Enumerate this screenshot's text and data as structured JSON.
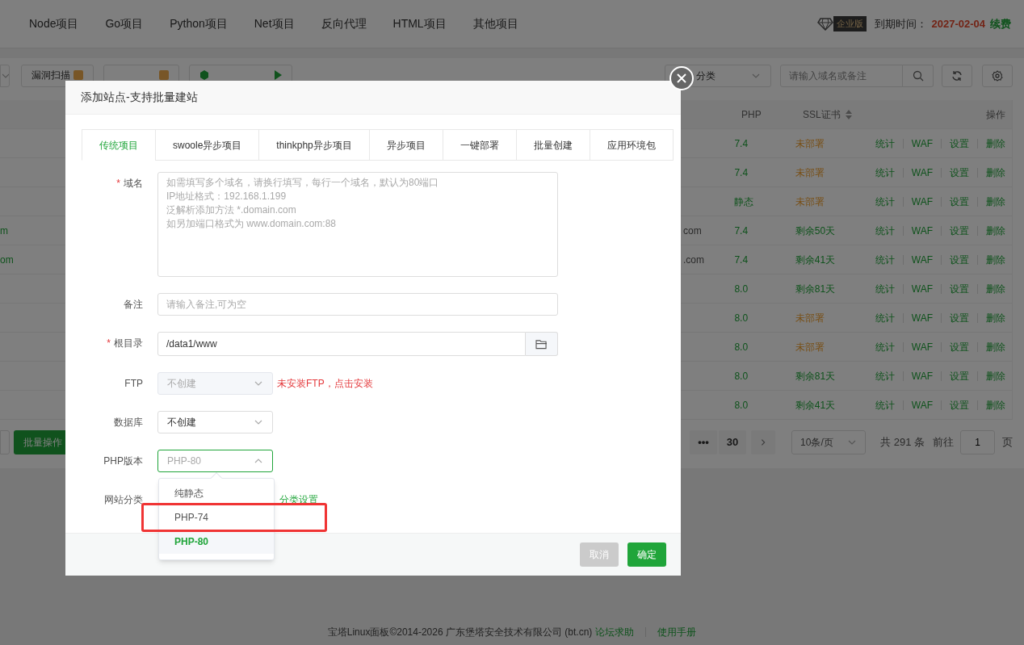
{
  "top_nav": {
    "items": [
      "Node项目",
      "Go项目",
      "Python项目",
      "Net项目",
      "反向代理",
      "HTML项目",
      "其他项目"
    ],
    "edition_badge": "企业版",
    "expiry_label": "到期时间：",
    "expiry_date": "2027-02-04",
    "renew_link": "续费"
  },
  "toolbar": {
    "left_buttons": [
      {
        "label": "漏洞扫描",
        "kind": "badge"
      },
      {
        "kind": "badge"
      },
      {
        "kind": "server"
      }
    ],
    "category_select": "分类",
    "search": {
      "placeholder": "请输入域名或备注"
    }
  },
  "table": {
    "columns": [
      "PHP",
      "SSL证书",
      "操作"
    ],
    "rows": [
      {
        "php": "7.4",
        "ssl": "未部署",
        "ssl_deployed": false,
        "actions": [
          "统计",
          "WAF",
          "设置",
          "删除"
        ]
      },
      {
        "php": "7.4",
        "ssl": "未部署",
        "ssl_deployed": false,
        "actions": [
          "统计",
          "WAF",
          "设置",
          "删除"
        ]
      },
      {
        "php": "静态",
        "ssl": "未部署",
        "ssl_deployed": false,
        "actions": [
          "统计",
          "WAF",
          "设置",
          "删除"
        ]
      },
      {
        "lead": "m",
        "tail": "com",
        "php": "7.4",
        "ssl": "剩余50天",
        "ssl_deployed": true,
        "actions": [
          "统计",
          "WAF",
          "设置",
          "删除"
        ]
      },
      {
        "lead": "om",
        "tail": ".com",
        "php": "7.4",
        "ssl": "剩余41天",
        "ssl_deployed": true,
        "actions": [
          "统计",
          "WAF",
          "设置",
          "删除"
        ]
      },
      {
        "php": "8.0",
        "ssl": "剩余81天",
        "ssl_deployed": true,
        "actions": [
          "统计",
          "WAF",
          "设置",
          "删除"
        ]
      },
      {
        "php": "8.0",
        "ssl": "未部署",
        "ssl_deployed": false,
        "actions": [
          "统计",
          "WAF",
          "设置",
          "删除"
        ]
      },
      {
        "php": "8.0",
        "ssl": "未部署",
        "ssl_deployed": false,
        "actions": [
          "统计",
          "WAF",
          "设置",
          "删除"
        ]
      },
      {
        "php": "8.0",
        "ssl": "剩余81天",
        "ssl_deployed": true,
        "actions": [
          "统计",
          "WAF",
          "设置",
          "删除"
        ]
      },
      {
        "php": "8.0",
        "ssl": "剩余41天",
        "ssl_deployed": true,
        "actions": [
          "统计",
          "WAF",
          "设置",
          "删除"
        ]
      }
    ]
  },
  "pagination": {
    "batch_button": "批量操作",
    "pages": [
      "•••",
      "30"
    ],
    "page_size": "10条/页",
    "total": "共 291 条",
    "goto_label": "前往",
    "goto_value": "1",
    "page_unit": "页"
  },
  "footer": {
    "copyright": "宝塔Linux面板©2014-2026 广东堡塔安全技术有限公司 (bt.cn)",
    "links": [
      "论坛求助",
      "使用手册"
    ]
  },
  "dialog": {
    "title": "添加站点-支持批量建站",
    "tabs": [
      {
        "label": "传统项目",
        "selected": true
      },
      {
        "label": "swoole异步项目",
        "selected": false
      },
      {
        "label": "thinkphp异步项目",
        "selected": false
      },
      {
        "label": "异步项目",
        "selected": false
      },
      {
        "label": "一键部署",
        "selected": false
      },
      {
        "label": "批量创建",
        "selected": false
      },
      {
        "label": "应用环境包",
        "selected": false
      }
    ],
    "fields": [
      {
        "kind": "textarea",
        "label": "域名",
        "required_mark": "*",
        "placeholder": "如需填写多个域名，请换行填写，每行一个域名，默认为80端口\nIP地址格式：192.168.1.199\n泛解析添加方法 *.domain.com\n如另加端口格式为 www.domain.com:88"
      },
      {
        "kind": "input",
        "label": "备注",
        "placeholder": "请输入备注,可为空"
      },
      {
        "kind": "path",
        "label": "根目录",
        "required_mark": "*",
        "value": "/data1/www"
      },
      {
        "kind": "select",
        "label": "FTP",
        "value": "不创建",
        "disabled": true,
        "note": "未安装FTP，点击安装"
      },
      {
        "kind": "select",
        "label": "数据库",
        "value": "不创建",
        "disabled": false
      },
      {
        "kind": "select",
        "label": "PHP版本",
        "placeholder": "PHP-80",
        "disabled": false,
        "expanded": true,
        "options": [
          {
            "label": "纯静态",
            "selected": false,
            "highlighted": false
          },
          {
            "label": "PHP-74",
            "selected": false,
            "highlighted": true
          },
          {
            "label": "PHP-80",
            "selected": true,
            "highlighted": false
          }
        ]
      },
      {
        "kind": "category",
        "label": "网站分类",
        "link": "分类设置"
      }
    ],
    "buttons": [
      {
        "label": "取消",
        "kind": "cancel"
      },
      {
        "label": "确定",
        "kind": "primary"
      }
    ]
  }
}
